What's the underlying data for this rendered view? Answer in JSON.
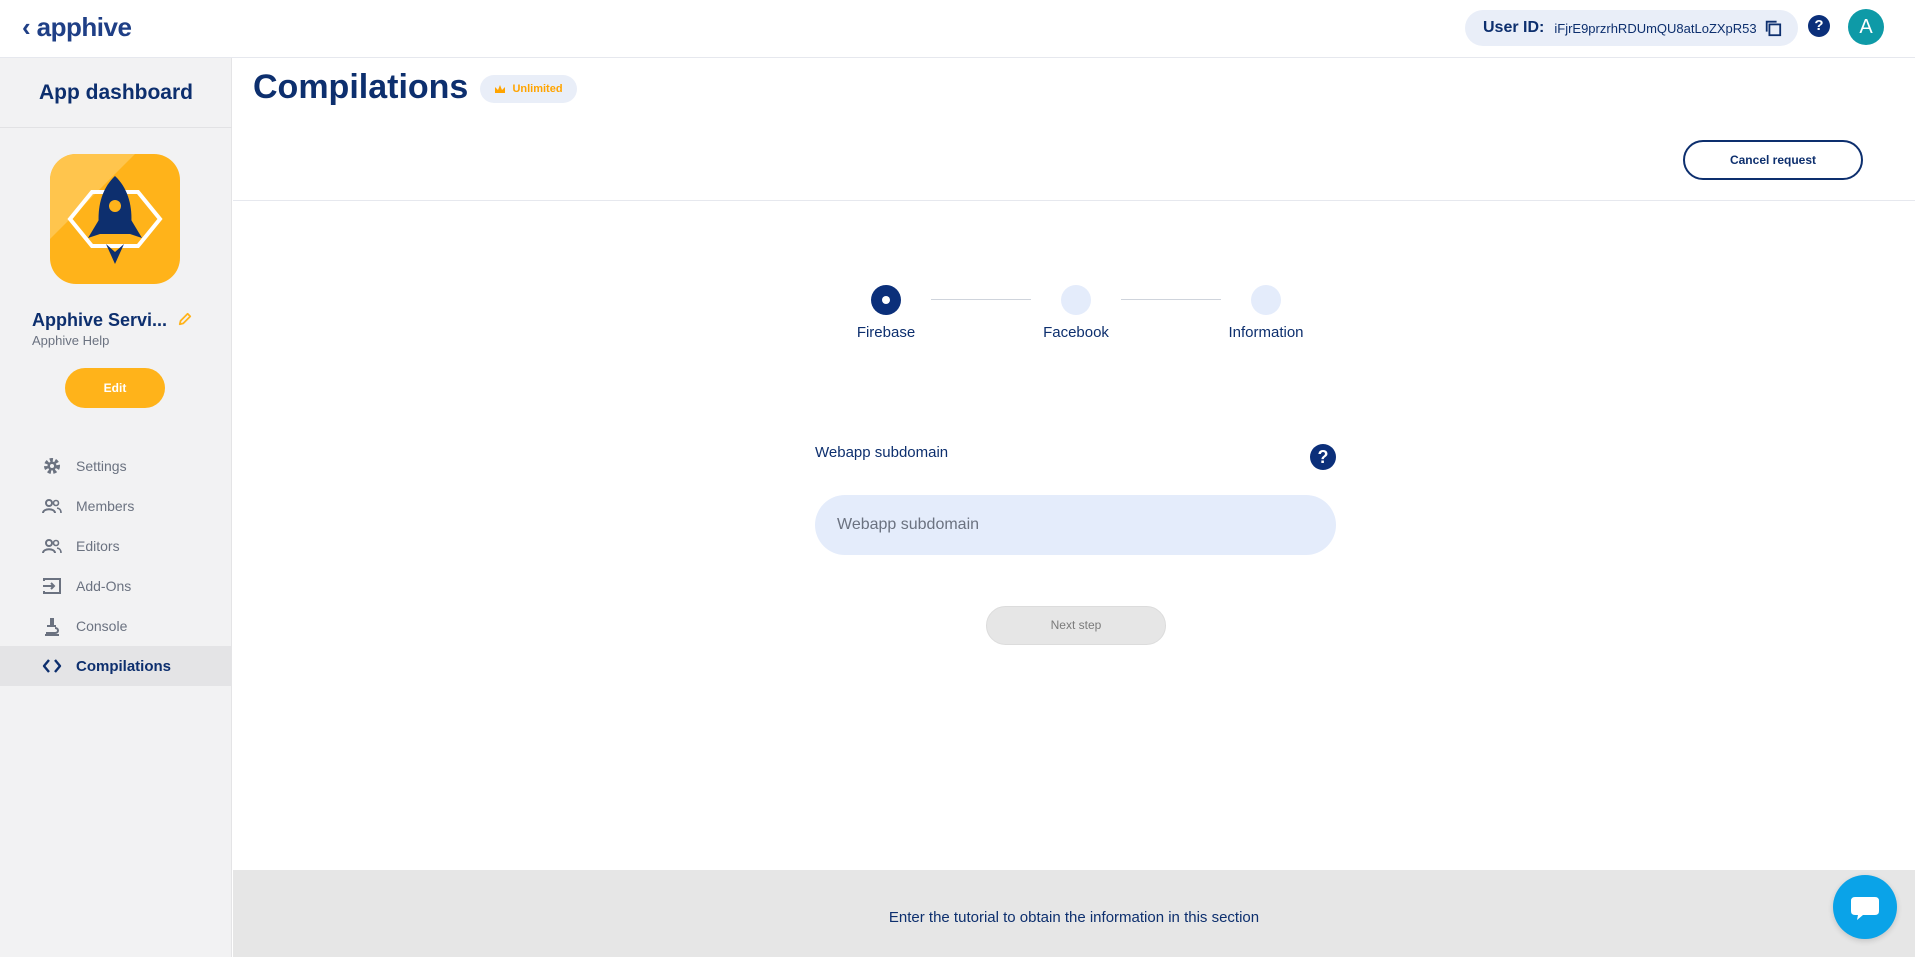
{
  "topbar": {
    "logo_text": "apphive",
    "user_id_label": "User ID:",
    "user_id_value": "iFjrE9przrhRDUmQU8atLoZXpR53",
    "avatar_letter": "A",
    "help_glyph": "?"
  },
  "sidebar": {
    "title": "App dashboard",
    "app_name": "Apphive Servi...",
    "app_subtitle": "Apphive Help",
    "edit_label": "Edit",
    "items": [
      {
        "label": "Settings",
        "icon": "gear-icon"
      },
      {
        "label": "Members",
        "icon": "people-icon"
      },
      {
        "label": "Editors",
        "icon": "people-icon"
      },
      {
        "label": "Add-Ons",
        "icon": "login-icon"
      },
      {
        "label": "Console",
        "icon": "microscope-icon"
      },
      {
        "label": "Compilations",
        "icon": "code-icon",
        "active": true
      }
    ]
  },
  "main": {
    "title": "Compilations",
    "badge": "Unlimited",
    "cancel_label": "Cancel request",
    "steps": [
      {
        "label": "Firebase",
        "state": "active"
      },
      {
        "label": "Facebook",
        "state": "pending"
      },
      {
        "label": "Information",
        "state": "pending"
      }
    ],
    "field_label": "Webapp subdomain",
    "field_placeholder": "Webapp subdomain",
    "field_value": "",
    "help_glyph": "?",
    "next_label": "Next step"
  },
  "footer": {
    "text": "Enter the tutorial to obtain the information in this section"
  },
  "colors": {
    "primary": "#0d2f6e",
    "accent": "#ffb31a",
    "avatar": "#0e9aa7",
    "chat": "#0aa3e8"
  }
}
